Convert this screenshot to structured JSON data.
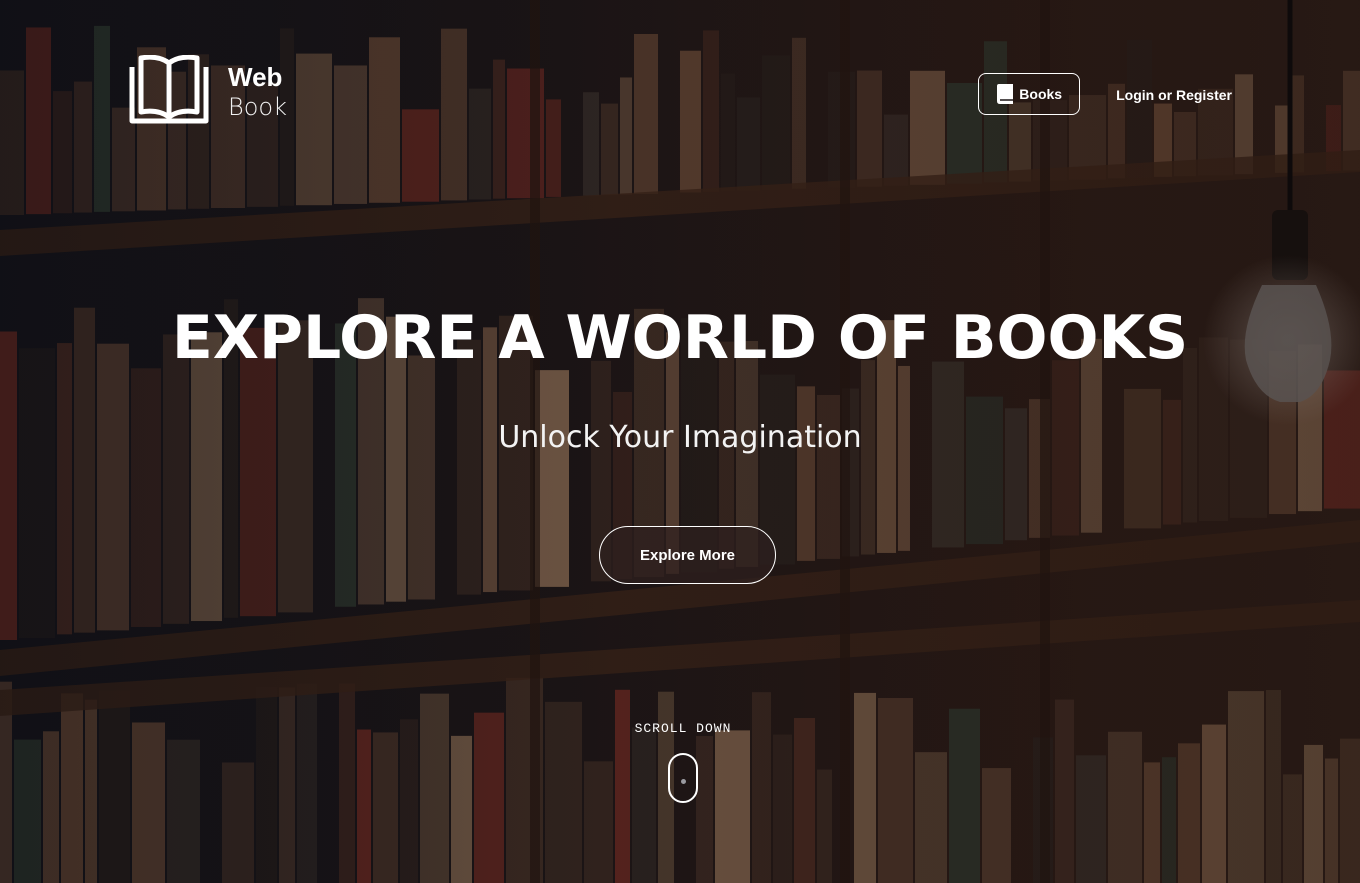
{
  "brand": {
    "name_line1": "Web",
    "name_line2": "Book",
    "logo_icon": "open-book-icon"
  },
  "nav": {
    "books_label": "Books",
    "books_icon": "book-icon",
    "login_label": "Login or Register"
  },
  "hero": {
    "headline": "EXPLORE A WORLD OF BOOKS",
    "subheadline": "Unlock Your Imagination",
    "cta_label": "Explore More",
    "scroll_label": "SCROLL DOWN",
    "scroll_icon": "mouse-scroll-icon"
  },
  "colors": {
    "text": "#ffffff",
    "cta_fill": "#2e201e",
    "background_dark": "#0e0b0c",
    "shelf_wood": "#3a2318"
  }
}
